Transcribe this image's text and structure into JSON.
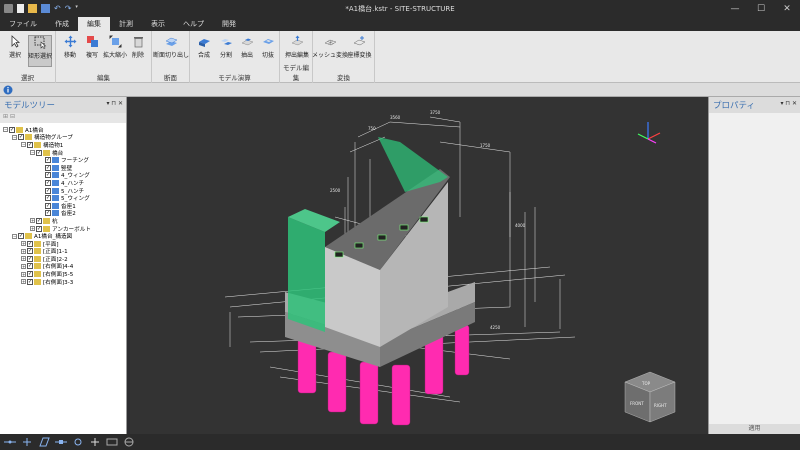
{
  "window": {
    "title": "*A1橋台.kstr - SITE-STRUCTURE"
  },
  "menu": {
    "tabs": [
      "ファイル",
      "作成",
      "編集",
      "計測",
      "表示",
      "ヘルプ",
      "開発"
    ],
    "active_index": 2
  },
  "ribbon": {
    "groups": [
      {
        "label": "選択",
        "buttons": [
          "選択",
          "矩形選択"
        ]
      },
      {
        "label": "編集",
        "buttons": [
          "移動",
          "複写",
          "拡大縮小",
          "削除"
        ]
      },
      {
        "label": "断面",
        "buttons": [
          "断面切り出し"
        ]
      },
      {
        "label": "モデル演算",
        "buttons": [
          "合成",
          "分割",
          "抽出",
          "切抜"
        ]
      },
      {
        "label": "モデル編集",
        "buttons": [
          "押出編集"
        ]
      },
      {
        "label": "変換",
        "buttons": [
          "メッシュ変換",
          "座標変換"
        ]
      }
    ]
  },
  "model_tree": {
    "title": "モデルツリー",
    "items": [
      {
        "label": "A1橋台",
        "depth": 0
      },
      {
        "label": "構造物グループ",
        "depth": 1
      },
      {
        "label": "構造物1",
        "depth": 2
      },
      {
        "label": "橋台",
        "depth": 3
      },
      {
        "label": "フーチング",
        "depth": 4
      },
      {
        "label": "竪壁",
        "depth": 4
      },
      {
        "label": "4_ウィング",
        "depth": 4
      },
      {
        "label": "4_ハンチ",
        "depth": 4
      },
      {
        "label": "5_ハンチ",
        "depth": 4
      },
      {
        "label": "5_ウィング",
        "depth": 4
      },
      {
        "label": "沓座1",
        "depth": 4
      },
      {
        "label": "沓座2",
        "depth": 4
      },
      {
        "label": "杭",
        "depth": 3
      },
      {
        "label": "アンカーボルト",
        "depth": 3
      },
      {
        "label": "A1橋台_構造図",
        "depth": 1
      },
      {
        "label": "[平面]",
        "depth": 2
      },
      {
        "label": "[正面]1-1",
        "depth": 2
      },
      {
        "label": "[正面]2-2",
        "depth": 2
      },
      {
        "label": "[右側面]4-4",
        "depth": 2
      },
      {
        "label": "[右側面]5-5",
        "depth": 2
      },
      {
        "label": "[右側面]3-3",
        "depth": 2
      }
    ]
  },
  "properties": {
    "title": "プロパティ",
    "apply_label": "適用"
  },
  "viewcube": {
    "top": "TOP",
    "front": "FRONT",
    "right": "RIGHT"
  },
  "colors": {
    "wing": "#2fc27a",
    "pile": "#ff2bb0",
    "concrete": "#c8c8c8",
    "viewport_bg": "#333333"
  }
}
